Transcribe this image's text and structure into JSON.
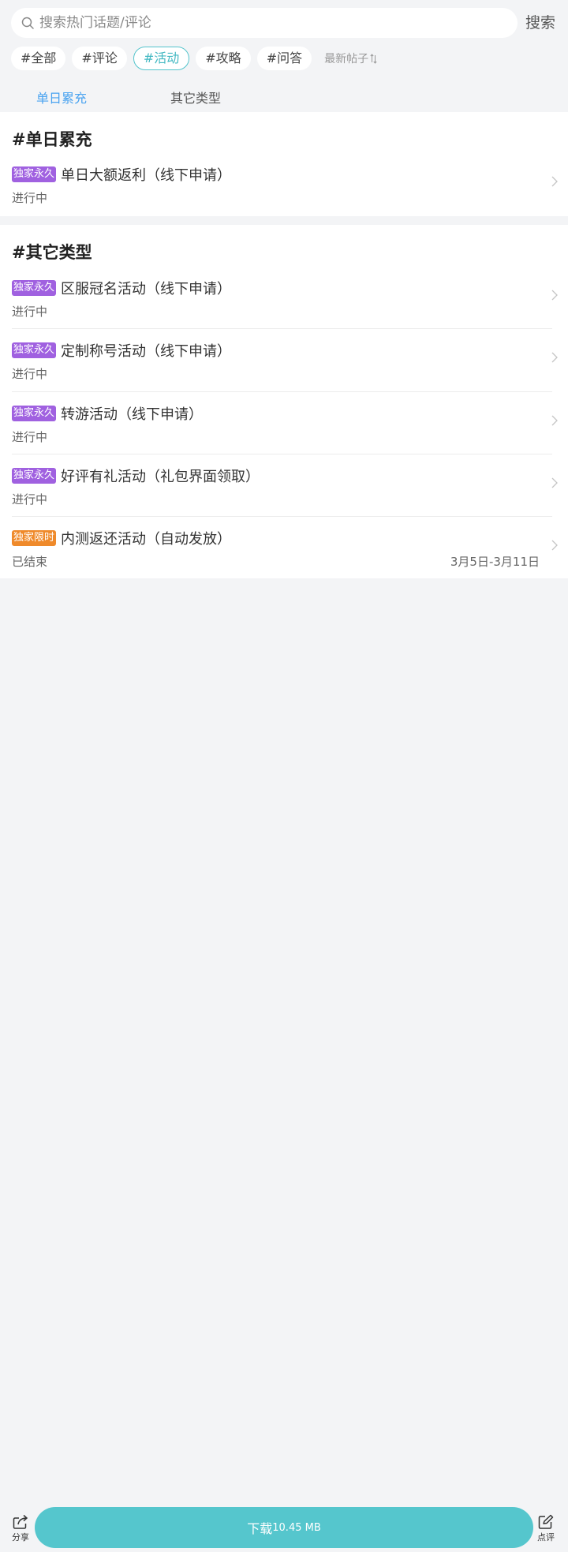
{
  "search": {
    "placeholder": "搜索热门话题/评论",
    "button_label": "搜索"
  },
  "filters": {
    "chips": [
      "#全部",
      "#评论",
      "#活动",
      "#攻略",
      "#问答"
    ],
    "active_chip": "#活动",
    "sort_label": "最新帖子"
  },
  "tabs": {
    "items": [
      "单日累充",
      "其它类型"
    ],
    "active": "单日累充"
  },
  "sections": [
    {
      "title": "#单日累充",
      "items": [
        {
          "badge": "独家永久",
          "title": "单日大额返利（线下申请）",
          "status": "进行中",
          "date": ""
        }
      ]
    },
    {
      "title": "#其它类型",
      "items": [
        {
          "badge": "独家永久",
          "title": "区服冠名活动（线下申请）",
          "status": "进行中",
          "date": ""
        },
        {
          "badge": "独家永久",
          "title": "定制称号活动（线下申请）",
          "status": "进行中",
          "date": ""
        },
        {
          "badge": "独家永久",
          "title": "转游活动（线下申请）",
          "status": "进行中",
          "date": ""
        },
        {
          "badge": "独家永久",
          "title": "好评有礼活动（礼包界面领取）",
          "status": "进行中",
          "date": ""
        },
        {
          "badge": "独家限时",
          "title": "内测返还活动（自动发放）",
          "status": "已结束",
          "date": "3月5日-3月11日"
        }
      ]
    }
  ],
  "bottom_bar": {
    "share_label": "分享",
    "download_label": "下载",
    "download_size": "10.45 MB",
    "review_label": "点评"
  },
  "colors": {
    "accent": "#55c6cd",
    "tab_active": "#4aa3f0",
    "badge_permanent": "#a061e0",
    "badge_limited": "#ef8a2b",
    "background": "#f3f4f6"
  },
  "icons": [
    "search-icon",
    "sort-icon",
    "chevron-right-icon",
    "share-icon",
    "edit-icon"
  ]
}
